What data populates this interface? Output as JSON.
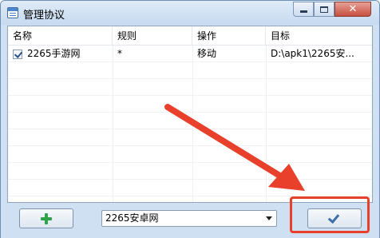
{
  "window": {
    "title": "管理协议",
    "controls": {
      "minimize": "minimize",
      "maximize": "maximize",
      "close": "✕"
    }
  },
  "table": {
    "columns": [
      "名称",
      "规则",
      "操作",
      "目标"
    ],
    "rows": [
      {
        "checked": true,
        "name": "2265手游网",
        "rule": "*",
        "action": "移动",
        "target": "D:\\apk1\\2265安..."
      }
    ]
  },
  "bottom": {
    "add_icon": "plus-icon",
    "select_value": "2265安卓网",
    "confirm_icon": "checkmark-icon"
  },
  "colors": {
    "annotation_red": "#e8402b",
    "plus_green": "#2fa34a",
    "check_blue": "#3f6da8"
  }
}
